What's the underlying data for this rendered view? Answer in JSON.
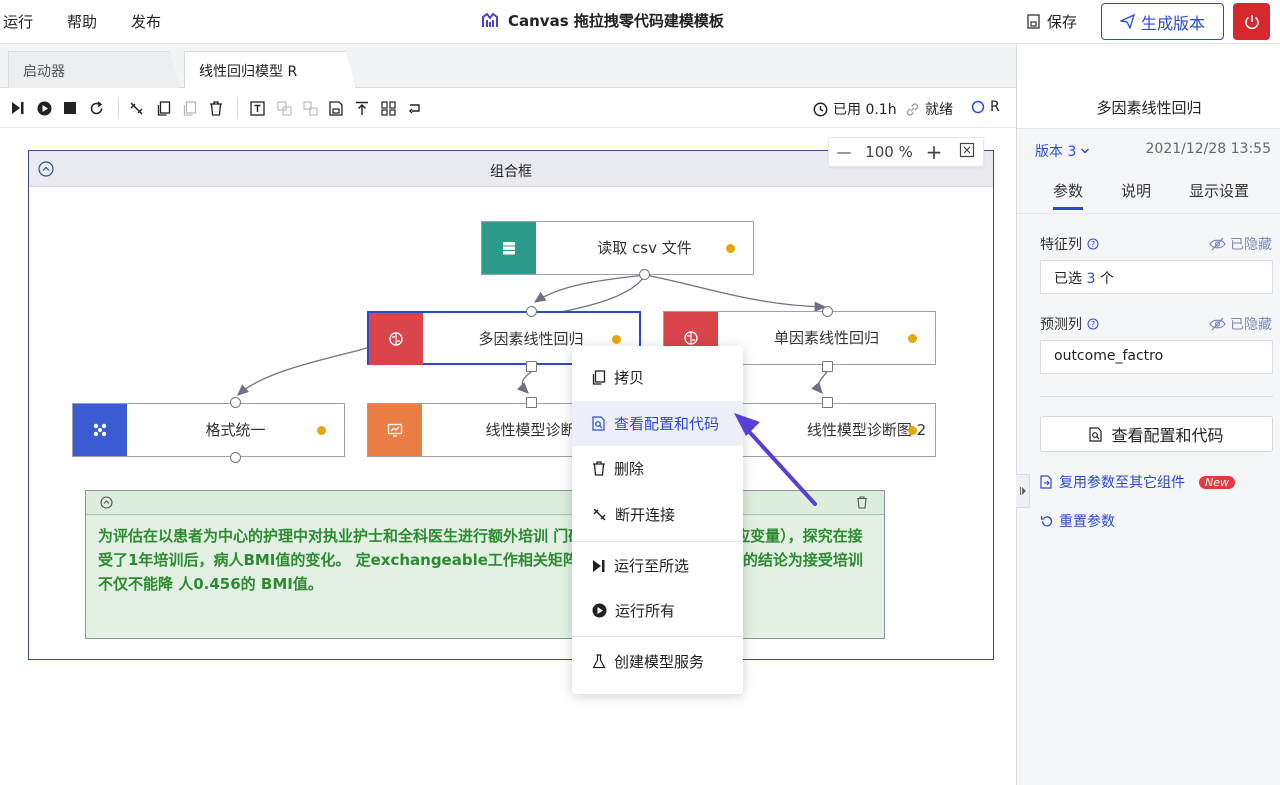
{
  "menubar": {
    "items": [
      "运行",
      "帮助",
      "发布"
    ],
    "title": "Canvas 拖拉拽零代码建模模板",
    "save_label": "保存",
    "generate_label": "生成版本"
  },
  "tabs": [
    "启动器",
    "线性回归模型 R"
  ],
  "toolbar": {
    "icons": [
      "run-step-icon",
      "run-icon",
      "stop-icon",
      "refresh-icon",
      "disconnect-icon",
      "copy-icon",
      "paste-icon",
      "delete-icon",
      "text-icon",
      "group-icon",
      "ungroup-icon",
      "save-icon",
      "align-top-icon",
      "layout-icon",
      "loop-icon"
    ],
    "used_label": "已用 0.1h",
    "status_label": "就绪",
    "kernel_label": "R"
  },
  "zoom": {
    "value": "100 %"
  },
  "group": {
    "title": "组合框"
  },
  "nodes": [
    {
      "label": "读取 csv 文件",
      "color": "#2a9a8a",
      "icon": "database-icon"
    },
    {
      "label": "多因素线性回归",
      "color": "#d9454b",
      "icon": "brain-icon"
    },
    {
      "label": "单因素线性回归",
      "color": "#d9454b",
      "icon": "brain-icon"
    },
    {
      "label": "格式统一",
      "color": "#3a5bd1",
      "icon": "format-icon"
    },
    {
      "label": "线性模型诊断",
      "color": "#ea7e45",
      "icon": "chart-monitor-icon"
    },
    {
      "label": "线性模型诊断图 2",
      "color": "#ea7e45",
      "icon": "chart-monitor-icon"
    }
  ],
  "note": {
    "text": "为评估在以患者为中心的护理中对执业护士和全科医生进行额外培训 门研究BMI数据集（连续响应变量），探究在接受了1年培训后，病人BMI值的变化。 定exchangeable工作相关矩阵）和随机效应模型，得到的结论为接受培训不仅不能降 人0.456的 BMI值。"
  },
  "context_menu": {
    "items": [
      "拷贝",
      "查看配置和代码",
      "删除",
      "断开连接",
      "运行至所选",
      "运行所有",
      "创建模型服务"
    ],
    "highlighted": "查看配置和代码"
  },
  "right_panel": {
    "title": "多因素线性回归",
    "version": "版本 3",
    "date": "2021/12/28 13:55",
    "tabs": [
      "参数",
      "说明",
      "显示设置"
    ],
    "active_tab": "参数",
    "feature_label": "特征列",
    "feature_hidden": "已隐藏",
    "feature_value_prefix": "已选",
    "feature_count": "3",
    "feature_value_suffix": "个",
    "target_label": "预测列",
    "target_hidden": "已隐藏",
    "target_value": "outcome_factro",
    "view_button": "查看配置和代码",
    "reuse_link": "复用参数至其它组件",
    "new_badge": "New",
    "reset_link": "重置参数"
  },
  "colors": {
    "accent": "#2a4ad6",
    "danger": "#d7282e",
    "note_text": "#2c8a2f"
  }
}
